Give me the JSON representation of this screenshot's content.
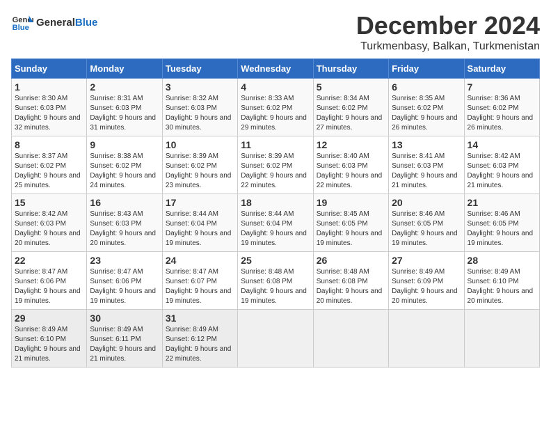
{
  "header": {
    "logo_line1": "General",
    "logo_line2": "Blue",
    "month_title": "December 2024",
    "location": "Turkmenbasy, Balkan, Turkmenistan"
  },
  "weekdays": [
    "Sunday",
    "Monday",
    "Tuesday",
    "Wednesday",
    "Thursday",
    "Friday",
    "Saturday"
  ],
  "weeks": [
    [
      {
        "day": "1",
        "sunrise": "Sunrise: 8:30 AM",
        "sunset": "Sunset: 6:03 PM",
        "daylight": "Daylight: 9 hours and 32 minutes."
      },
      {
        "day": "2",
        "sunrise": "Sunrise: 8:31 AM",
        "sunset": "Sunset: 6:03 PM",
        "daylight": "Daylight: 9 hours and 31 minutes."
      },
      {
        "day": "3",
        "sunrise": "Sunrise: 8:32 AM",
        "sunset": "Sunset: 6:03 PM",
        "daylight": "Daylight: 9 hours and 30 minutes."
      },
      {
        "day": "4",
        "sunrise": "Sunrise: 8:33 AM",
        "sunset": "Sunset: 6:02 PM",
        "daylight": "Daylight: 9 hours and 29 minutes."
      },
      {
        "day": "5",
        "sunrise": "Sunrise: 8:34 AM",
        "sunset": "Sunset: 6:02 PM",
        "daylight": "Daylight: 9 hours and 27 minutes."
      },
      {
        "day": "6",
        "sunrise": "Sunrise: 8:35 AM",
        "sunset": "Sunset: 6:02 PM",
        "daylight": "Daylight: 9 hours and 26 minutes."
      },
      {
        "day": "7",
        "sunrise": "Sunrise: 8:36 AM",
        "sunset": "Sunset: 6:02 PM",
        "daylight": "Daylight: 9 hours and 26 minutes."
      }
    ],
    [
      {
        "day": "8",
        "sunrise": "Sunrise: 8:37 AM",
        "sunset": "Sunset: 6:02 PM",
        "daylight": "Daylight: 9 hours and 25 minutes."
      },
      {
        "day": "9",
        "sunrise": "Sunrise: 8:38 AM",
        "sunset": "Sunset: 6:02 PM",
        "daylight": "Daylight: 9 hours and 24 minutes."
      },
      {
        "day": "10",
        "sunrise": "Sunrise: 8:39 AM",
        "sunset": "Sunset: 6:02 PM",
        "daylight": "Daylight: 9 hours and 23 minutes."
      },
      {
        "day": "11",
        "sunrise": "Sunrise: 8:39 AM",
        "sunset": "Sunset: 6:02 PM",
        "daylight": "Daylight: 9 hours and 22 minutes."
      },
      {
        "day": "12",
        "sunrise": "Sunrise: 8:40 AM",
        "sunset": "Sunset: 6:03 PM",
        "daylight": "Daylight: 9 hours and 22 minutes."
      },
      {
        "day": "13",
        "sunrise": "Sunrise: 8:41 AM",
        "sunset": "Sunset: 6:03 PM",
        "daylight": "Daylight: 9 hours and 21 minutes."
      },
      {
        "day": "14",
        "sunrise": "Sunrise: 8:42 AM",
        "sunset": "Sunset: 6:03 PM",
        "daylight": "Daylight: 9 hours and 21 minutes."
      }
    ],
    [
      {
        "day": "15",
        "sunrise": "Sunrise: 8:42 AM",
        "sunset": "Sunset: 6:03 PM",
        "daylight": "Daylight: 9 hours and 20 minutes."
      },
      {
        "day": "16",
        "sunrise": "Sunrise: 8:43 AM",
        "sunset": "Sunset: 6:03 PM",
        "daylight": "Daylight: 9 hours and 20 minutes."
      },
      {
        "day": "17",
        "sunrise": "Sunrise: 8:44 AM",
        "sunset": "Sunset: 6:04 PM",
        "daylight": "Daylight: 9 hours and 19 minutes."
      },
      {
        "day": "18",
        "sunrise": "Sunrise: 8:44 AM",
        "sunset": "Sunset: 6:04 PM",
        "daylight": "Daylight: 9 hours and 19 minutes."
      },
      {
        "day": "19",
        "sunrise": "Sunrise: 8:45 AM",
        "sunset": "Sunset: 6:05 PM",
        "daylight": "Daylight: 9 hours and 19 minutes."
      },
      {
        "day": "20",
        "sunrise": "Sunrise: 8:46 AM",
        "sunset": "Sunset: 6:05 PM",
        "daylight": "Daylight: 9 hours and 19 minutes."
      },
      {
        "day": "21",
        "sunrise": "Sunrise: 8:46 AM",
        "sunset": "Sunset: 6:05 PM",
        "daylight": "Daylight: 9 hours and 19 minutes."
      }
    ],
    [
      {
        "day": "22",
        "sunrise": "Sunrise: 8:47 AM",
        "sunset": "Sunset: 6:06 PM",
        "daylight": "Daylight: 9 hours and 19 minutes."
      },
      {
        "day": "23",
        "sunrise": "Sunrise: 8:47 AM",
        "sunset": "Sunset: 6:06 PM",
        "daylight": "Daylight: 9 hours and 19 minutes."
      },
      {
        "day": "24",
        "sunrise": "Sunrise: 8:47 AM",
        "sunset": "Sunset: 6:07 PM",
        "daylight": "Daylight: 9 hours and 19 minutes."
      },
      {
        "day": "25",
        "sunrise": "Sunrise: 8:48 AM",
        "sunset": "Sunset: 6:08 PM",
        "daylight": "Daylight: 9 hours and 19 minutes."
      },
      {
        "day": "26",
        "sunrise": "Sunrise: 8:48 AM",
        "sunset": "Sunset: 6:08 PM",
        "daylight": "Daylight: 9 hours and 20 minutes."
      },
      {
        "day": "27",
        "sunrise": "Sunrise: 8:49 AM",
        "sunset": "Sunset: 6:09 PM",
        "daylight": "Daylight: 9 hours and 20 minutes."
      },
      {
        "day": "28",
        "sunrise": "Sunrise: 8:49 AM",
        "sunset": "Sunset: 6:10 PM",
        "daylight": "Daylight: 9 hours and 20 minutes."
      }
    ],
    [
      {
        "day": "29",
        "sunrise": "Sunrise: 8:49 AM",
        "sunset": "Sunset: 6:10 PM",
        "daylight": "Daylight: 9 hours and 21 minutes."
      },
      {
        "day": "30",
        "sunrise": "Sunrise: 8:49 AM",
        "sunset": "Sunset: 6:11 PM",
        "daylight": "Daylight: 9 hours and 21 minutes."
      },
      {
        "day": "31",
        "sunrise": "Sunrise: 8:49 AM",
        "sunset": "Sunset: 6:12 PM",
        "daylight": "Daylight: 9 hours and 22 minutes."
      },
      null,
      null,
      null,
      null
    ]
  ]
}
